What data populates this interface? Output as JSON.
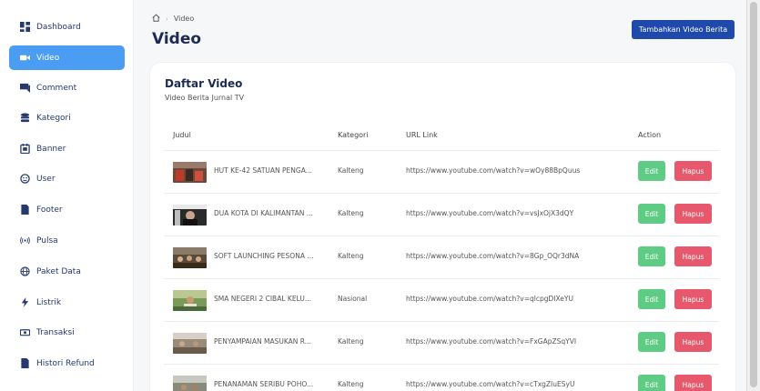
{
  "sidebar": {
    "items": [
      {
        "label": "Dashboard",
        "icon": "dashboard-grid-icon"
      },
      {
        "label": "Video",
        "icon": "video-camera-icon"
      },
      {
        "label": "Comment",
        "icon": "comment-icon"
      },
      {
        "label": "Kategori",
        "icon": "database-stack-icon"
      },
      {
        "label": "Banner",
        "icon": "calendar-icon"
      },
      {
        "label": "User",
        "icon": "user-face-icon"
      },
      {
        "label": "Footer",
        "icon": "file-icon"
      },
      {
        "label": "Pulsa",
        "icon": "broadcast-icon"
      },
      {
        "label": "Paket Data",
        "icon": "globe-icon"
      },
      {
        "label": "Listrik",
        "icon": "lightning-icon"
      },
      {
        "label": "Transaksi",
        "icon": "cash-icon"
      },
      {
        "label": "Histori Refund",
        "icon": "file-icon"
      }
    ],
    "active_color": "#4a9df3"
  },
  "breadcrumb": {
    "current": "Video",
    "home_icon": "home-icon"
  },
  "header": {
    "title": "Video",
    "add_button": "Tambahkan Video Berita"
  },
  "card": {
    "title": "Daftar Video",
    "subtitle": "Video Berita Jurnal TV"
  },
  "table": {
    "headers": {
      "judul": "Judul",
      "kategori": "Kategori",
      "url": "URL Link",
      "action": "Action"
    },
    "rows": [
      {
        "judul": "HUT KE-42 SATUAN PENGA...",
        "kategori": "Kalteng",
        "url": "https://www.youtube.com/watch?v=wOy88BpQuus",
        "edit": "Edit",
        "hapus": "Hapus"
      },
      {
        "judul": "DUA KOTA DI KALIMANTAN ...",
        "kategori": "Kalteng",
        "url": "https://www.youtube.com/watch?v=vsJxOjX3dQY",
        "edit": "Edit",
        "hapus": "Hapus"
      },
      {
        "judul": "SOFT LAUNCHING PESONA ...",
        "kategori": "Kalteng",
        "url": "https://www.youtube.com/watch?v=8Gp_OQr3dNA",
        "edit": "Edit",
        "hapus": "Hapus"
      },
      {
        "judul": "SMA NEGERI 2 CIBAL KELU...",
        "kategori": "Nasional",
        "url": "https://www.youtube.com/watch?v=qlcpgDIXeYU",
        "edit": "Edit",
        "hapus": "Hapus"
      },
      {
        "judul": "PENYAMPAIAN MASUKAN R...",
        "kategori": "Kalteng",
        "url": "https://www.youtube.com/watch?v=FxGApZSqYVI",
        "edit": "Edit",
        "hapus": "Hapus"
      },
      {
        "judul": "PENANAMAN SERIBU POHO...",
        "kategori": "Kalteng",
        "url": "https://www.youtube.com/watch?v=cTxgZIuESyU",
        "edit": "Edit",
        "hapus": "Hapus"
      }
    ]
  },
  "colors": {
    "primary": "#1f49ad",
    "edit": "#5fcc85",
    "hapus": "#e8586c"
  }
}
